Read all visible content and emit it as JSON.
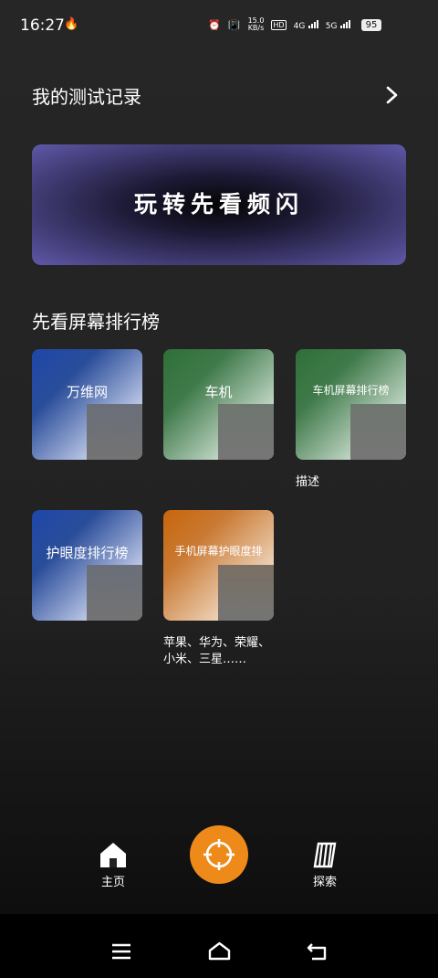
{
  "status_bar": {
    "time": "16:27",
    "net_speed_value": "15.0",
    "net_speed_unit": "KB/s",
    "sim1_tech": "4G",
    "sim2_tech": "5G",
    "battery": "95"
  },
  "header": {
    "title": "我的测试记录"
  },
  "banner": {
    "text": "玩转先看频闪"
  },
  "ranking_section": {
    "title": "先看屏幕排行榜",
    "cards": [
      {
        "label": "万维网",
        "description": ""
      },
      {
        "label": "车机",
        "description": ""
      },
      {
        "label": "车机屏幕排行榜",
        "description": "描述"
      },
      {
        "label": "护眼度排行榜",
        "description": ""
      },
      {
        "label": "手机屏幕护眼度排",
        "description_line1": "苹果、华为、荣耀、",
        "description_line2": "小米、三星……"
      }
    ]
  },
  "bottom_nav": {
    "home_label": "主页",
    "explore_label": "探索"
  },
  "colors": {
    "accent": "#ee8a1a",
    "banner_edge": "#5f58a8",
    "card_blue": "#1e47a8",
    "card_green": "#2e7038",
    "card_orange": "#c8650b"
  },
  "icons": [
    "flame-icon",
    "alarm-icon",
    "vibrate-icon",
    "hd-icon",
    "signal-icon",
    "chevron-right-icon",
    "home-icon",
    "target-icon",
    "explore-icon",
    "menu-icon",
    "home-outline-icon",
    "back-icon"
  ]
}
